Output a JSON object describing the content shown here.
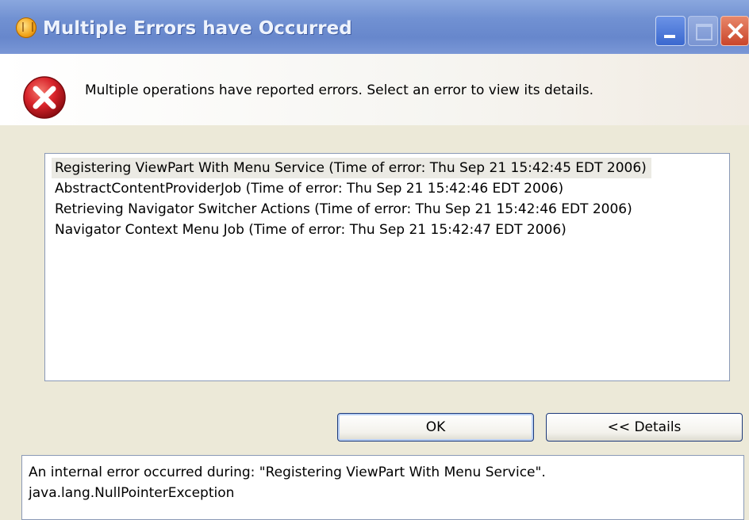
{
  "window": {
    "title": "Multiple Errors have Occurred",
    "app_icon": "eclipse-icon"
  },
  "message": "Multiple operations have reported errors. Select an error to view its details.",
  "errors": [
    "Registering ViewPart With Menu Service (Time of error: Thu Sep 21 15:42:45 EDT 2006)",
    "AbstractContentProviderJob (Time of error: Thu Sep 21 15:42:46 EDT 2006)",
    "Retrieving Navigator Switcher Actions (Time of error: Thu Sep 21 15:42:46 EDT 2006)",
    "Navigator Context Menu Job (Time of error: Thu Sep 21 15:42:47 EDT 2006)"
  ],
  "selected_error_index": 0,
  "buttons": {
    "ok": "OK",
    "details": "<< Details"
  },
  "details_text": {
    "line1": "An internal error occurred during: \"Registering ViewPart With Menu Service\".",
    "line2": "java.lang.NullPointerException"
  },
  "colors": {
    "error_red": "#d8232a",
    "titlebar_blue": "#7191d2",
    "dialog_bg": "#ece9d8"
  }
}
